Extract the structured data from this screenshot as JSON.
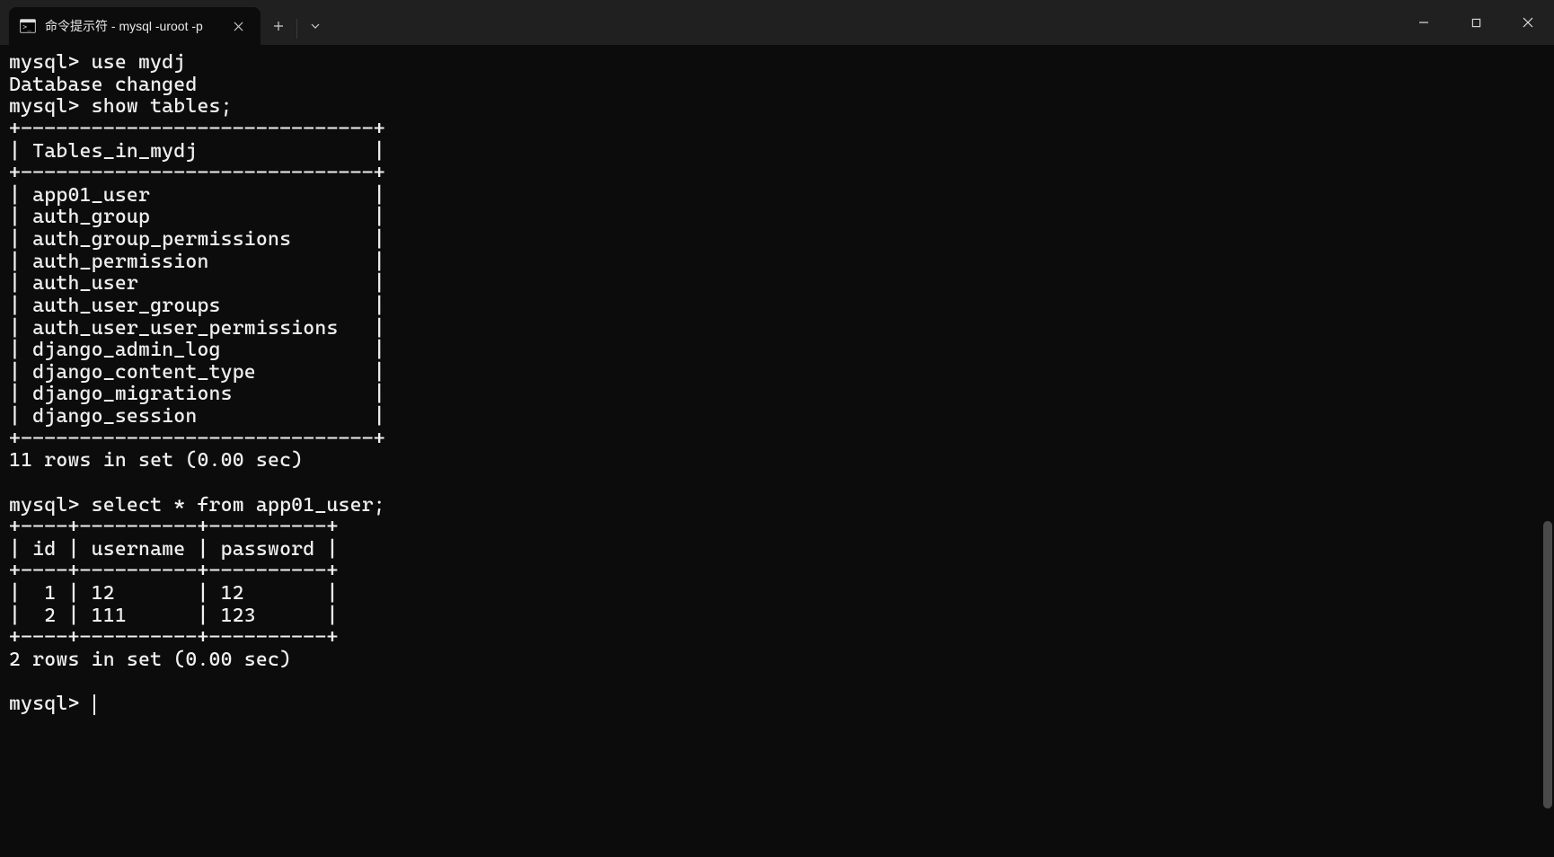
{
  "window": {
    "tab_title": "命令提示符 - mysql  -uroot -p"
  },
  "terminal": {
    "prompt": "mysql>",
    "cmd_use": "use mydj",
    "db_changed": "Database changed",
    "cmd_show_tables": "show tables;",
    "tables_header": "Tables_in_mydj",
    "tables": [
      "app01_user",
      "auth_group",
      "auth_group_permissions",
      "auth_permission",
      "auth_user",
      "auth_user_groups",
      "auth_user_user_permissions",
      "django_admin_log",
      "django_content_type",
      "django_migrations",
      "django_session"
    ],
    "tables_footer": "11 rows in set (0.00 sec)",
    "cmd_select": "select * from app01_user;",
    "user_table": {
      "columns": [
        "id",
        "username",
        "password"
      ],
      "rows": [
        {
          "id": 1,
          "username": "12",
          "password": "12"
        },
        {
          "id": 2,
          "username": "111",
          "password": "123"
        }
      ]
    },
    "select_footer": "2 rows in set (0.00 sec)"
  }
}
